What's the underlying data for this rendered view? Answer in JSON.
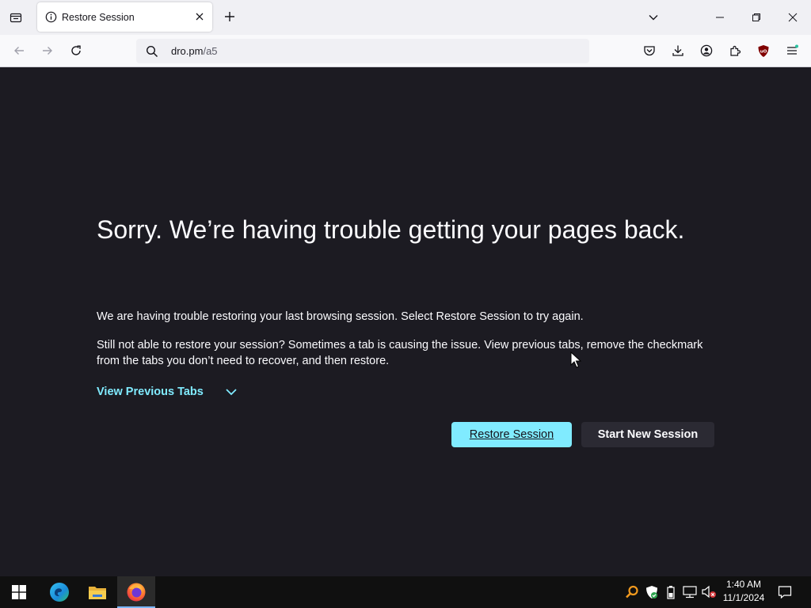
{
  "browser": {
    "tab": {
      "title": "Restore Session"
    },
    "url": {
      "host": "dro.pm",
      "path": "/a5"
    }
  },
  "content": {
    "title": "Sorry. We’re having trouble getting your pages back.",
    "paragraph1": "We are having trouble restoring your last browsing session. Select Restore Session to try again.",
    "paragraph2": "Still not able to restore your session? Sometimes a tab is causing the issue. View previous tabs, remove the checkmark from the tabs you don’t need to recover, and then restore.",
    "view_previous_tabs": "View Previous Tabs",
    "restore_button": "Restore Session",
    "new_session_button": "Start New Session"
  },
  "taskbar": {
    "time": "1:40 AM",
    "date": "11/1/2024"
  },
  "colors": {
    "accent": "#80ebff",
    "page_bg": "#1c1b22",
    "secondary_button": "#2b2a33"
  },
  "icons": [
    "tab-list-icon",
    "info-icon",
    "close-icon",
    "plus-icon",
    "chevron-down-icon",
    "minimize-icon",
    "restore-icon",
    "back-icon",
    "forward-icon",
    "reload-icon",
    "search-icon",
    "pocket-icon",
    "download-icon",
    "account-icon",
    "extensions-icon",
    "ublock-icon",
    "menu-icon",
    "windows-start-icon",
    "edge-icon",
    "file-explorer-icon",
    "firefox-icon",
    "search-tray-icon",
    "defender-icon",
    "battery-icon",
    "network-icon",
    "volume-muted-icon",
    "notifications-icon"
  ]
}
